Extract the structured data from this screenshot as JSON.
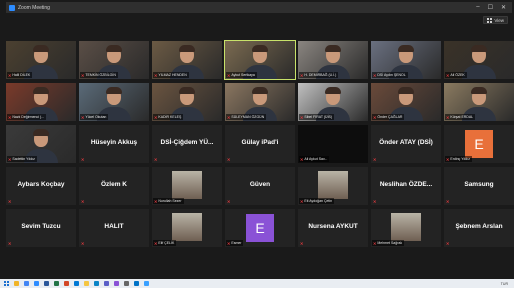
{
  "window": {
    "title": "Zoom Meeting",
    "minimize": "–",
    "maximize": "☐",
    "close": "✕"
  },
  "view_button": {
    "label": "View"
  },
  "colors": {
    "active_speaker_border": "#c8e26a",
    "muted_mic": "#e0393e",
    "avatar_orange": "#e8703a",
    "avatar_purple": "#8a52d6"
  },
  "tiles": [
    {
      "kind": "video",
      "label": "Halil DİLEK",
      "bg": "#4b4030"
    },
    {
      "kind": "video",
      "label": "TEMKİN ÖZBİLGİN",
      "bg": "#5a4e46"
    },
    {
      "kind": "video",
      "label": "YILMAZ HENDEN",
      "bg": "#6b5a44"
    },
    {
      "kind": "video",
      "label": "Aykut Sertkaya",
      "bg": "#7a6a50",
      "active": true
    },
    {
      "kind": "video",
      "label": "H. DEMİRBAĞ (U.İ.)",
      "bg": "#8a8580"
    },
    {
      "kind": "video",
      "label": "DSİ Aydın ŞENOL",
      "bg": "#6a7080"
    },
    {
      "kind": "video",
      "label": "Ali ÖZEK",
      "bg": "#3a3228"
    },
    {
      "kind": "video",
      "label": "Nazlı Değirmenci (...",
      "bg": "#7a3a2a"
    },
    {
      "kind": "video",
      "label": "Yücel Okutan",
      "bg": "#5a6a78"
    },
    {
      "kind": "video",
      "label": "KADİR KELEŞ",
      "bg": "#6a5440"
    },
    {
      "kind": "video",
      "label": "SÜLEYMAN ÖZGÜN",
      "bg": "#8a7660"
    },
    {
      "kind": "video",
      "label": "Sibel FIRAT (ÜİS)",
      "bg": "#c0c0c0"
    },
    {
      "kind": "video",
      "label": "Önder ÇAĞLAR",
      "bg": "#6a4a3a"
    },
    {
      "kind": "video",
      "label": "Kürşat ERDAL",
      "bg": "#8a7a60"
    },
    {
      "kind": "video",
      "label": "Sadettin Yıldız",
      "bg": "#3a3a3a"
    },
    {
      "kind": "name",
      "name": "Hüseyin Akkuş",
      "label": "Hüseyin Akkuş"
    },
    {
      "kind": "name",
      "name": "DSİ-Çiğdem YÜ...",
      "label": "DSİ-Çiğdem YÜ..."
    },
    {
      "kind": "name",
      "name": "Gülay iPad'i",
      "label": "Gülay iPad'i"
    },
    {
      "kind": "black",
      "label": "Ali Aykut Sav..."
    },
    {
      "kind": "name",
      "name": "Önder ATAY (DSİ)",
      "label": "Önder ATAY (DSİ)"
    },
    {
      "kind": "avatar",
      "letter": "E",
      "label": "Erdinç Yıldız",
      "color": "orange"
    },
    {
      "kind": "name",
      "name": "Aybars Koçbay",
      "label": "Aybars Koçbay"
    },
    {
      "kind": "name",
      "name": "Özlem K",
      "label": "Özlem K"
    },
    {
      "kind": "photo",
      "label": "Nurullah Sezer"
    },
    {
      "kind": "name",
      "name": "Güven",
      "label": "Güven"
    },
    {
      "kind": "photo",
      "label": "Eti Aydoğan Çetin"
    },
    {
      "kind": "name",
      "name": "Neslihan ÖZDE...",
      "label": "Neslihan ÖZDE..."
    },
    {
      "kind": "name",
      "name": "Samsung",
      "label": "Samsung"
    },
    {
      "kind": "name",
      "name": "Sevim Tuzcu",
      "label": "Sevim Tuzcu"
    },
    {
      "kind": "name",
      "name": "HALIT",
      "label": "HALIT"
    },
    {
      "kind": "photo",
      "label": "Elif ÇELİK"
    },
    {
      "kind": "avatar",
      "letter": "E",
      "label": "Esmer",
      "color": "purple"
    },
    {
      "kind": "name",
      "name": "Nursena AYKUT",
      "label": "Nursena AYKUT"
    },
    {
      "kind": "photo",
      "label": "Mehmet Sağrak"
    },
    {
      "kind": "name",
      "name": "Şebnem Arslan",
      "label": "Şebnem Arslan"
    }
  ],
  "taskbar": {
    "apps": [
      "explorer-icon",
      "chrome-icon",
      "zoom-icon",
      "word-icon",
      "excel-icon",
      "powerpoint-icon",
      "outlook-icon",
      "folder-icon",
      "edge-icon",
      "teams-icon",
      "photos-icon",
      "settings-icon",
      "mail-icon",
      "store-icon"
    ],
    "tray_text": "TUR"
  }
}
